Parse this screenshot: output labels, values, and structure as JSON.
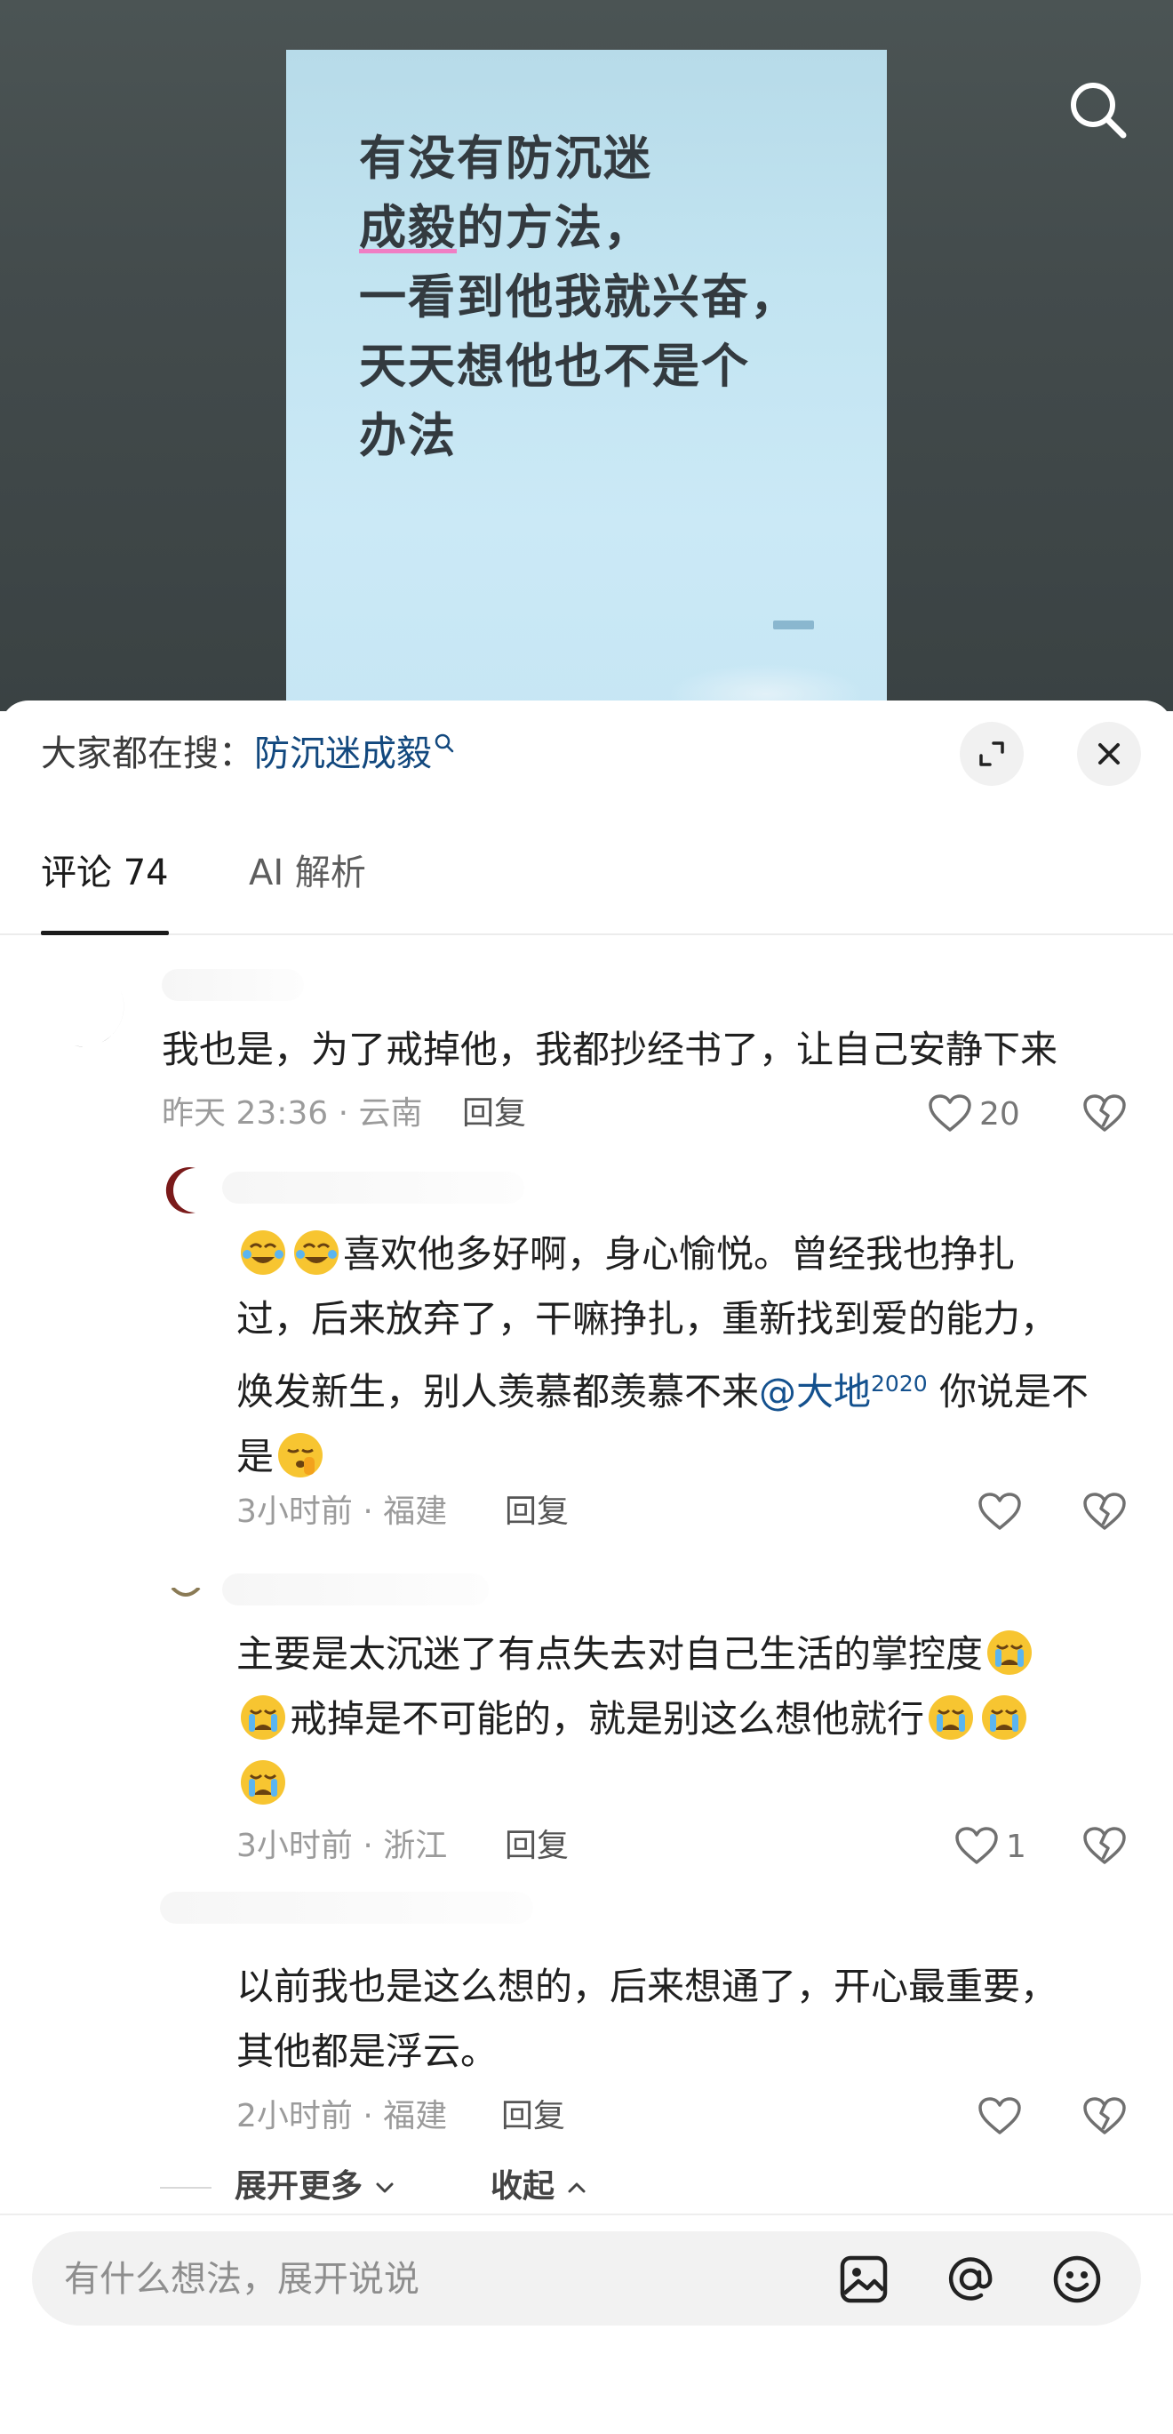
{
  "video": {
    "caption_lines": [
      "有没有防沉迷",
      "成毅",
      "的方法，",
      "一看到他我就兴奋，",
      "天天想他也不是个",
      "办法"
    ]
  },
  "header": {
    "hot_search_prefix": "大家都在搜：",
    "hot_search_term": "防沉迷成毅"
  },
  "tabs": [
    {
      "label": "评论 74",
      "active": true
    },
    {
      "label": "AI 解析",
      "active": false
    }
  ],
  "comments": [
    {
      "text_lines": [
        "我也是，为了戒掉他，我都抄经书了，让自己安静下来"
      ],
      "meta": "昨天 23:36 · 云南",
      "reply_label": "回复",
      "likes": "20"
    },
    {
      "lines": [
        {
          "after_emoji": "喜欢他多好啊，身心愉悦。曾经我也挣扎"
        },
        {
          "text": "过，后来放弃了，干嘛挣扎，重新找到爱的能力，"
        },
        {
          "text": "焕发新生，别人羡慕都羡慕不来",
          "mention": "@大地",
          "sup": "2020",
          "tail": " 你说是不"
        },
        {
          "text": "是"
        }
      ],
      "meta": "3小时前 · 福建",
      "reply_label": "回复",
      "likes": ""
    },
    {
      "text_lines": [
        "主要是太沉迷了有点失去对自己生活的掌控度",
        "戒掉是不可能的，就是别这么想他就行"
      ],
      "meta": "3小时前 · 浙江",
      "reply_label": "回复",
      "likes": "1"
    },
    {
      "text_lines": [
        "以前我也是这么想的，后来想通了，开心最重要，",
        "其他都是浮云。"
      ],
      "meta": "2小时前 · 福建",
      "reply_label": "回复",
      "likes": ""
    }
  ],
  "expand": {
    "more_label": "展开更多",
    "collapse_label": "收起"
  },
  "composer": {
    "placeholder": "有什么想法，展开说说"
  }
}
